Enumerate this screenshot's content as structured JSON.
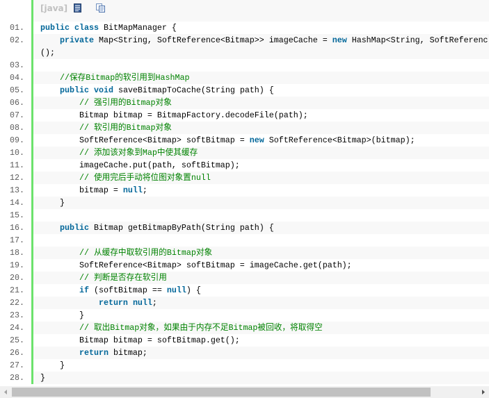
{
  "toolbar": {
    "language_label": "[java]",
    "view_plain_icon": "view-plain-icon",
    "copy_icon": "copy-icon"
  },
  "colors": {
    "keyword": "#006699",
    "comment": "#008200",
    "text": "#000000",
    "line_number": "#5c5c5c",
    "gutter_bar": "#6ce26c",
    "alt_row": "#f8f8f8"
  },
  "code": {
    "lines": [
      {
        "number": "01.",
        "tokens": [
          {
            "text": "public",
            "color": "#006699"
          },
          {
            "text": " ",
            "color": "#000000"
          },
          {
            "text": "class",
            "color": "#006699"
          },
          {
            "text": " BitMapManager {",
            "color": "#000000"
          }
        ]
      },
      {
        "number": "02.",
        "tokens": [
          {
            "text": "    ",
            "color": "#000000"
          },
          {
            "text": "private",
            "color": "#006699"
          },
          {
            "text": " Map<String, SoftReference<Bitmap>> imageCache = ",
            "color": "#000000"
          },
          {
            "text": "new",
            "color": "#006699"
          },
          {
            "text": " HashMap<String, SoftReferenc",
            "color": "#000000"
          }
        ],
        "continuation": [
          {
            "text": "();",
            "color": "#000000"
          }
        ]
      },
      {
        "number": "03.",
        "tokens": []
      },
      {
        "number": "04.",
        "tokens": [
          {
            "text": "    ",
            "color": "#000000"
          },
          {
            "text": "//保存Bitmap的软引用到HashMap",
            "color": "#008200"
          }
        ]
      },
      {
        "number": "05.",
        "tokens": [
          {
            "text": "    ",
            "color": "#000000"
          },
          {
            "text": "public",
            "color": "#006699"
          },
          {
            "text": " ",
            "color": "#000000"
          },
          {
            "text": "void",
            "color": "#006699"
          },
          {
            "text": " saveBitmapToCache(String path) {",
            "color": "#000000"
          }
        ]
      },
      {
        "number": "06.",
        "tokens": [
          {
            "text": "        ",
            "color": "#000000"
          },
          {
            "text": "// 强引用的Bitmap对象",
            "color": "#008200"
          }
        ]
      },
      {
        "number": "07.",
        "tokens": [
          {
            "text": "        Bitmap bitmap = BitmapFactory.decodeFile(path);",
            "color": "#000000"
          }
        ]
      },
      {
        "number": "08.",
        "tokens": [
          {
            "text": "        ",
            "color": "#000000"
          },
          {
            "text": "// 软引用的Bitmap对象",
            "color": "#008200"
          }
        ]
      },
      {
        "number": "09.",
        "tokens": [
          {
            "text": "        SoftReference<Bitmap> softBitmap = ",
            "color": "#000000"
          },
          {
            "text": "new",
            "color": "#006699"
          },
          {
            "text": " SoftReference<Bitmap>(bitmap);",
            "color": "#000000"
          }
        ]
      },
      {
        "number": "10.",
        "tokens": [
          {
            "text": "        ",
            "color": "#000000"
          },
          {
            "text": "// 添加该对象到Map中使其缓存",
            "color": "#008200"
          }
        ]
      },
      {
        "number": "11.",
        "tokens": [
          {
            "text": "        imageCache.put(path, softBitmap);",
            "color": "#000000"
          }
        ]
      },
      {
        "number": "12.",
        "tokens": [
          {
            "text": "        ",
            "color": "#000000"
          },
          {
            "text": "// 使用完后手动将位图对象置null",
            "color": "#008200"
          }
        ]
      },
      {
        "number": "13.",
        "tokens": [
          {
            "text": "        bitmap = ",
            "color": "#000000"
          },
          {
            "text": "null",
            "color": "#006699"
          },
          {
            "text": ";",
            "color": "#000000"
          }
        ]
      },
      {
        "number": "14.",
        "tokens": [
          {
            "text": "    }",
            "color": "#000000"
          }
        ]
      },
      {
        "number": "15.",
        "tokens": []
      },
      {
        "number": "16.",
        "tokens": [
          {
            "text": "    ",
            "color": "#000000"
          },
          {
            "text": "public",
            "color": "#006699"
          },
          {
            "text": " Bitmap getBitmapByPath(String path) {",
            "color": "#000000"
          }
        ]
      },
      {
        "number": "17.",
        "tokens": []
      },
      {
        "number": "18.",
        "tokens": [
          {
            "text": "        ",
            "color": "#000000"
          },
          {
            "text": "// 从缓存中取软引用的Bitmap对象",
            "color": "#008200"
          }
        ]
      },
      {
        "number": "19.",
        "tokens": [
          {
            "text": "        SoftReference<Bitmap> softBitmap = imageCache.get(path);",
            "color": "#000000"
          }
        ]
      },
      {
        "number": "20.",
        "tokens": [
          {
            "text": "        ",
            "color": "#000000"
          },
          {
            "text": "// 判断是否存在软引用",
            "color": "#008200"
          }
        ]
      },
      {
        "number": "21.",
        "tokens": [
          {
            "text": "        ",
            "color": "#000000"
          },
          {
            "text": "if",
            "color": "#006699"
          },
          {
            "text": " (softBitmap == ",
            "color": "#000000"
          },
          {
            "text": "null",
            "color": "#006699"
          },
          {
            "text": ") {",
            "color": "#000000"
          }
        ]
      },
      {
        "number": "22.",
        "tokens": [
          {
            "text": "            ",
            "color": "#000000"
          },
          {
            "text": "return",
            "color": "#006699"
          },
          {
            "text": " ",
            "color": "#000000"
          },
          {
            "text": "null",
            "color": "#006699"
          },
          {
            "text": ";",
            "color": "#000000"
          }
        ]
      },
      {
        "number": "23.",
        "tokens": [
          {
            "text": "        }",
            "color": "#000000"
          }
        ]
      },
      {
        "number": "24.",
        "tokens": [
          {
            "text": "        ",
            "color": "#000000"
          },
          {
            "text": "// 取出Bitmap对象，如果由于内存不足Bitmap被回收，将取得空",
            "color": "#008200"
          }
        ]
      },
      {
        "number": "25.",
        "tokens": [
          {
            "text": "        Bitmap bitmap = softBitmap.get();",
            "color": "#000000"
          }
        ]
      },
      {
        "number": "26.",
        "tokens": [
          {
            "text": "        ",
            "color": "#000000"
          },
          {
            "text": "return",
            "color": "#006699"
          },
          {
            "text": " bitmap;",
            "color": "#000000"
          }
        ]
      },
      {
        "number": "27.",
        "tokens": [
          {
            "text": "    }",
            "color": "#000000"
          }
        ]
      },
      {
        "number": "28.",
        "tokens": [
          {
            "text": "}",
            "color": "#000000"
          }
        ]
      }
    ]
  },
  "scrollbar": {
    "left_arrow_icon": "scroll-left-arrow-icon",
    "right_arrow_icon": "scroll-right-arrow-icon",
    "scroll_fraction": 0,
    "visible_fraction": 0.9
  }
}
